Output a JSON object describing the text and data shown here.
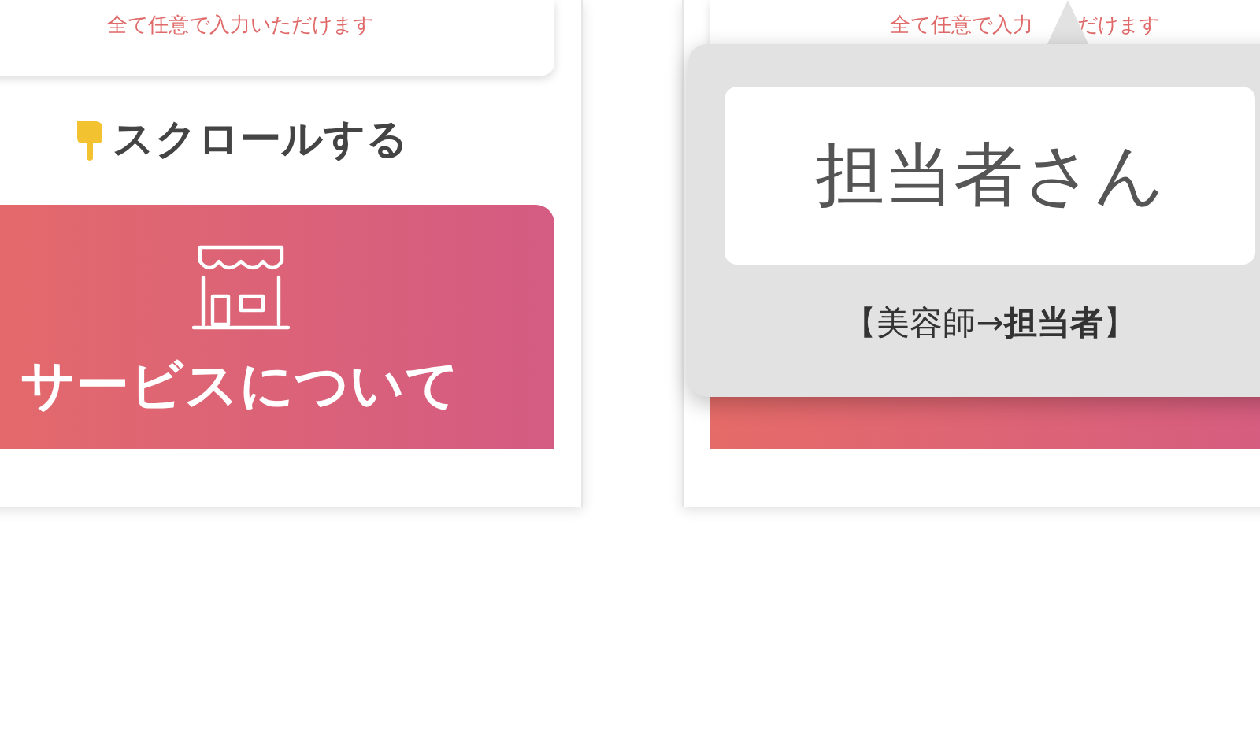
{
  "left_screen": {
    "notice": "全て任意で入力いただけます",
    "scroll_hint": "スクロールする",
    "service_card": {
      "label": "サービスについて"
    }
  },
  "right_screen": {
    "notice_parts": [
      "全て任意で入力",
      "だけます"
    ],
    "popup": {
      "word": "担当者さん",
      "note": "【美容師→**担当者**】"
    }
  }
}
